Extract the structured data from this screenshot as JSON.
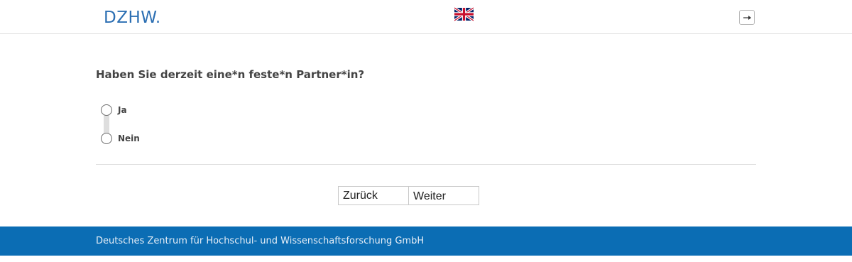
{
  "header": {
    "logo_text": "DZHW.",
    "language_flag": "uk-flag-icon",
    "logout_icon": "logout-arrow-icon"
  },
  "question": {
    "text": "Haben Sie derzeit eine*n feste*n Partner*in?",
    "options": [
      {
        "label": "Ja",
        "selected": false
      },
      {
        "label": "Nein",
        "selected": false
      }
    ]
  },
  "navigation": {
    "back_label": "Zurück",
    "next_label": "Weiter"
  },
  "footer": {
    "text": "Deutsches Zentrum für Hochschul- und Wissenschaftsforschung GmbH"
  },
  "colors": {
    "brand_blue": "#2c6fb3",
    "footer_blue": "#0b6db4"
  }
}
